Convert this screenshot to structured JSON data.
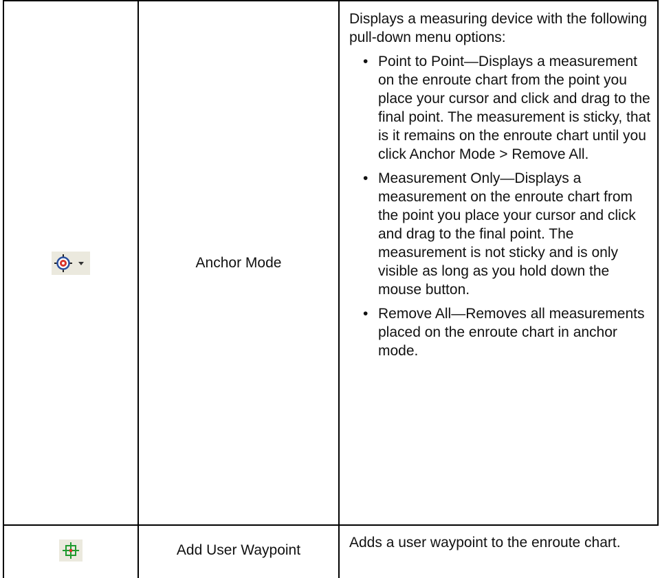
{
  "rows": [
    {
      "icon": "anchor-mode-target-icon",
      "icon_extra": "dropdown-arrow-icon",
      "name": "Anchor Mode",
      "description_intro": "Displays a measuring device with the following pull-down menu options:",
      "bullets": [
        "Point to Point—Displays a measurement on the enroute chart from the point you place your cursor and click and drag to the final point. The measurement is sticky, that is it remains on the enroute chart until you click Anchor Mode > Remove All.",
        "Measurement Only—Displays a measurement on the enroute chart from the point you place your cursor and click and drag to the final point. The measurement is not sticky and is only visible as long as you hold down the mouse button.",
        "Remove All—Removes all measurements placed on the enroute chart in anchor mode."
      ]
    },
    {
      "icon": "add-user-waypoint-icon",
      "name": "Add User Waypoint",
      "description_intro": "Adds a user waypoint to the enroute chart."
    }
  ],
  "bullet_glyph": "•",
  "colors": {
    "border": "#000000",
    "icon_background": "#ebe9de",
    "target_red": "#d9342b",
    "target_blue": "#2a4f9e",
    "waypoint_green": "#1e9a2e"
  }
}
